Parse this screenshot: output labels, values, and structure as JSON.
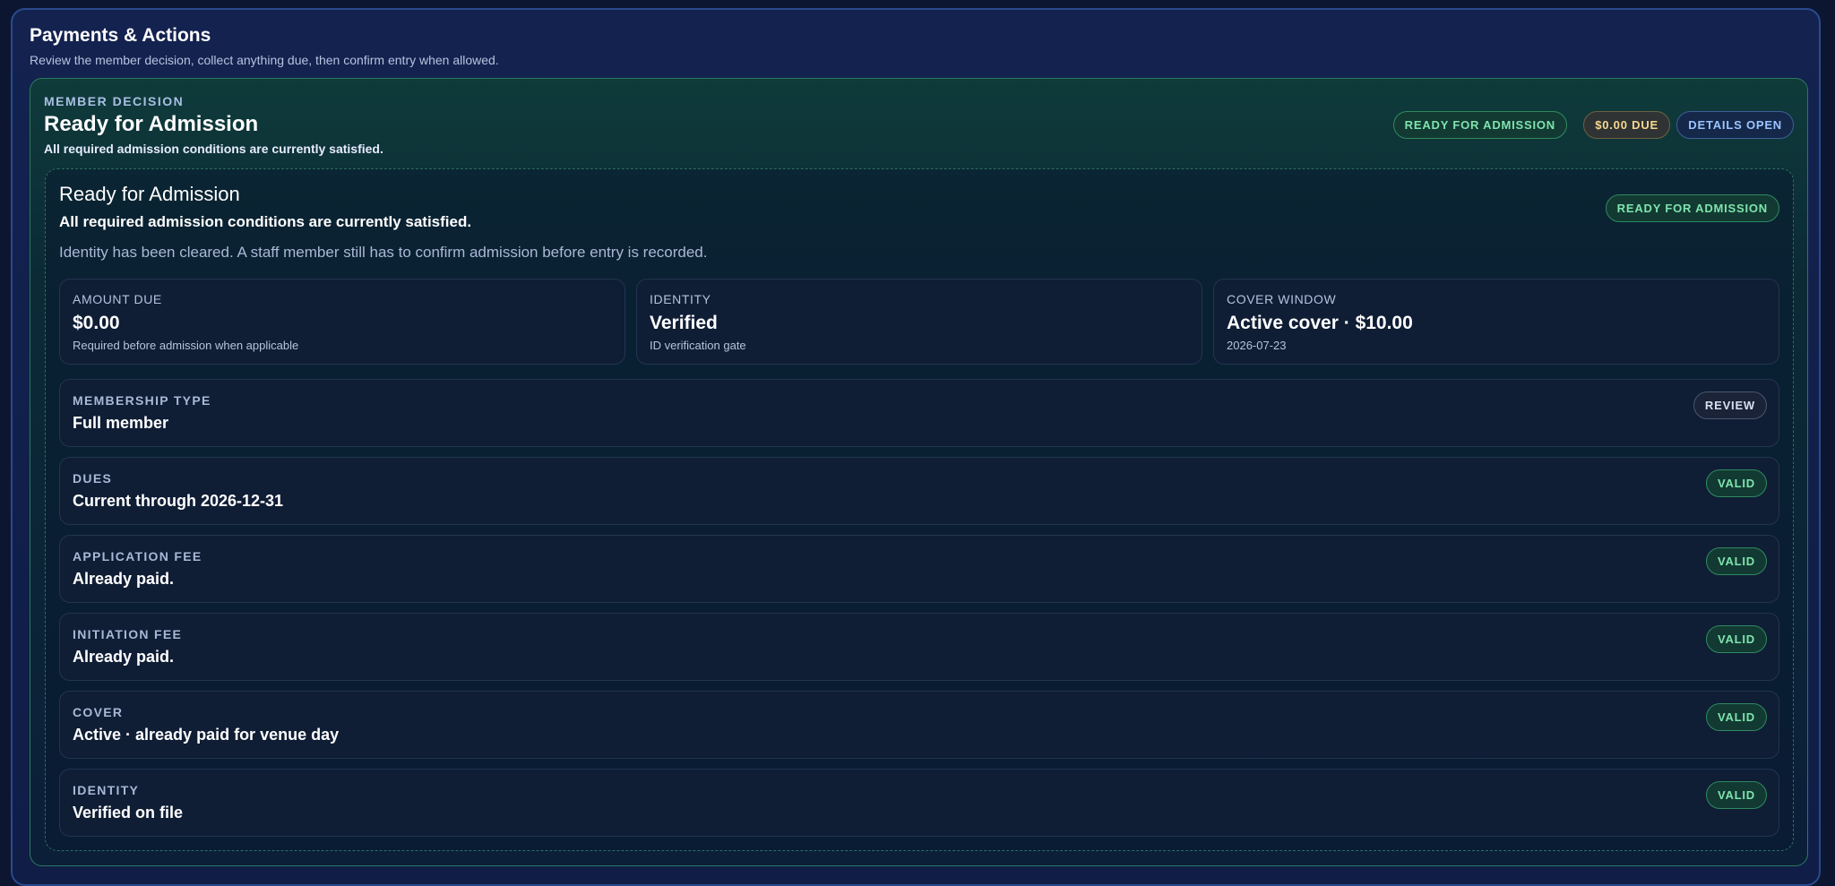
{
  "header": {
    "title": "Payments & Actions",
    "subtitle": "Review the member decision, collect anything due, then confirm entry when allowed."
  },
  "decision": {
    "eyebrow": "MEMBER DECISION",
    "title": "Ready for Admission",
    "subtitle": "All required admission conditions are currently satisfied.",
    "badges": {
      "status": "READY FOR ADMISSION",
      "due": "$0.00 DUE",
      "details": "DETAILS OPEN"
    }
  },
  "details": {
    "title": "Ready for Admission",
    "subtitle": "All required admission conditions are currently satisfied.",
    "note": "Identity has been cleared. A staff member still has to confirm admission before entry is recorded.",
    "badge": "READY FOR ADMISSION",
    "stats": [
      {
        "label": "AMOUNT DUE",
        "value": "$0.00",
        "note": "Required before admission when applicable"
      },
      {
        "label": "IDENTITY",
        "value": "Verified",
        "note": "ID verification gate"
      },
      {
        "label": "COVER WINDOW",
        "value": "Active cover · $10.00",
        "note": "2026-07-23"
      }
    ],
    "checks": [
      {
        "label": "MEMBERSHIP TYPE",
        "value": "Full member",
        "status": "REVIEW"
      },
      {
        "label": "DUES",
        "value": "Current through 2026-12-31",
        "status": "VALID"
      },
      {
        "label": "APPLICATION FEE",
        "value": "Already paid.",
        "status": "VALID"
      },
      {
        "label": "INITIATION FEE",
        "value": "Already paid.",
        "status": "VALID"
      },
      {
        "label": "COVER",
        "value": "Active · already paid for venue day",
        "status": "VALID"
      },
      {
        "label": "IDENTITY",
        "value": "Verified on file",
        "status": "VALID"
      }
    ]
  },
  "colors": {
    "background": "#0d1630",
    "panel_border": "#2a4a8e",
    "success": "#7fe4ad",
    "warning": "#f6d88e",
    "info": "#9cc4ff"
  }
}
